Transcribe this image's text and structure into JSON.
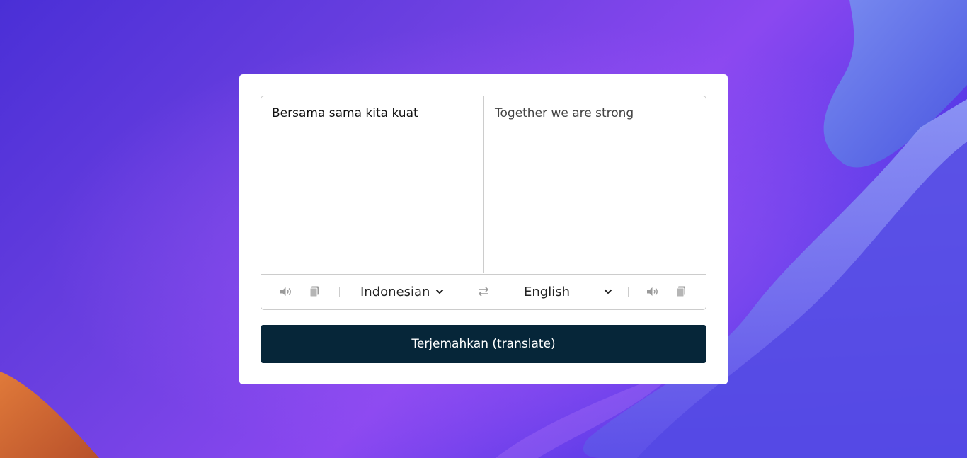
{
  "translator": {
    "from_text": "Bersama sama kita kuat",
    "to_text": "Together we are strong",
    "from_language": "Indonesian",
    "to_language": "English",
    "translate_button_label": "Terjemahkan (translate)"
  },
  "icons": {
    "from_speak": "volume-icon",
    "from_copy": "copy-icon",
    "exchange": "exchange-arrows-icon",
    "to_speak": "volume-icon",
    "to_copy": "copy-icon"
  },
  "colors": {
    "button_bg": "#062639",
    "card_bg": "#ffffff",
    "border": "#cccccc",
    "icon": "#9a9a9a"
  }
}
